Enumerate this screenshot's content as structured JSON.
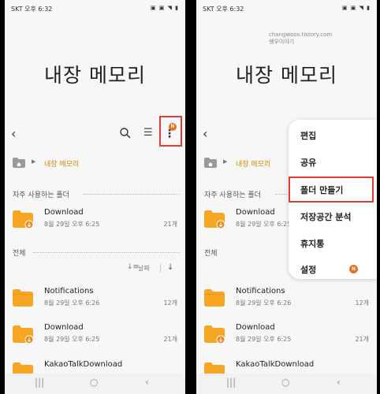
{
  "status": {
    "carrier": "SKT",
    "time": "오후 6:32",
    "icons": "▣ ▣ ◥ ▮"
  },
  "big_title": "내장 메모리",
  "watermark": {
    "line1": "changwoos.tistory.com",
    "line2": "쌩우이야기"
  },
  "toolbar": {
    "back": "‹",
    "list": "☰",
    "more": "⋮",
    "badge": "N"
  },
  "breadcrumb": {
    "arrow": "▶",
    "label": "내장 메모리"
  },
  "sections": {
    "frequent": "자주 사용하는 폴더",
    "all": "전체"
  },
  "sort": {
    "icon": "↓≡",
    "label": "날짜",
    "direction": "↓"
  },
  "left_rows": [
    {
      "name": "Download",
      "meta": "8월 29일 오후 6:25",
      "count": "21개"
    },
    {
      "name": "Notifications",
      "meta": "8월 29일 오후 6:26",
      "count": "12개"
    },
    {
      "name": "Download",
      "meta": "8월 29일 오후 6:25",
      "count": "21개"
    },
    {
      "name": "KakaoTalkDownload"
    }
  ],
  "right_rows": [
    {
      "name": "Download",
      "meta": "8월 29일 오후 6:25"
    },
    {
      "name": "Notifications",
      "meta": "8월 29일 오후 6:26",
      "count": "12개"
    },
    {
      "name": "Download",
      "meta": "8월 29일 오후 6:25",
      "count": "21개"
    },
    {
      "name": "KakaoTalkDownload"
    }
  ],
  "menu": {
    "items": [
      "편집",
      "공유",
      "폴더 만들기",
      "저장공간 분석",
      "휴지통",
      "설정"
    ],
    "settings_badge": "N"
  },
  "navbar": {
    "recent": "|||",
    "home": "○",
    "back": "‹"
  },
  "colors": {
    "accent": "#d08b00",
    "folder": "#f6a623",
    "badge": "#e8711f",
    "highlight": "#e53935"
  }
}
